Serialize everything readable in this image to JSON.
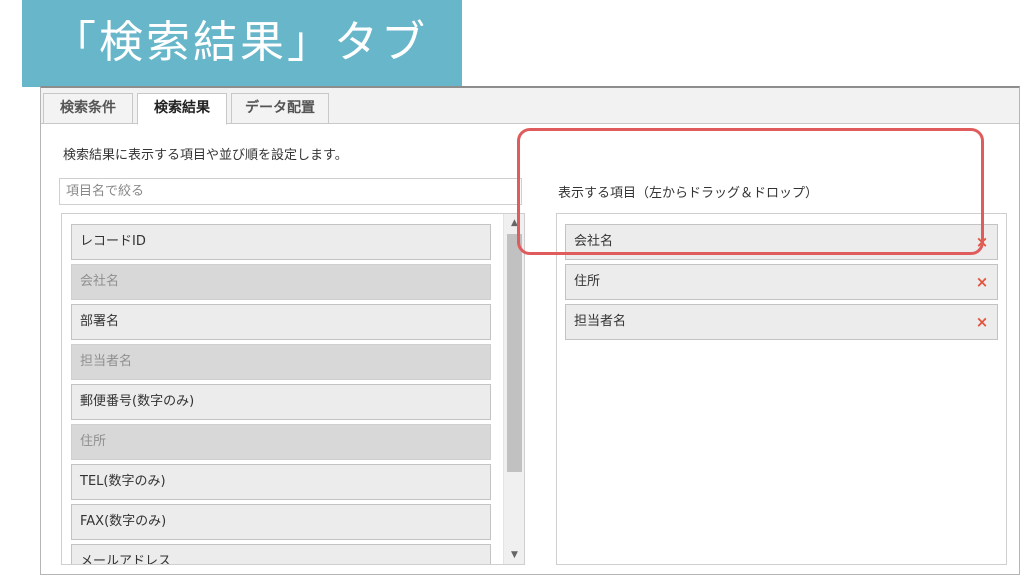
{
  "banner": {
    "title": "「検索結果」タブ"
  },
  "tabs": [
    {
      "label": "検索条件",
      "active": false
    },
    {
      "label": "検索結果",
      "active": true
    },
    {
      "label": "データ配置",
      "active": false
    }
  ],
  "description": "検索結果に表示する項目や並び順を設定します。",
  "filter": {
    "placeholder": "項目名で絞る",
    "value": ""
  },
  "available_items": [
    {
      "label": "レコードID",
      "selected": false
    },
    {
      "label": "会社名",
      "selected": true
    },
    {
      "label": "部署名",
      "selected": false
    },
    {
      "label": "担当者名",
      "selected": true
    },
    {
      "label": "郵便番号(数字のみ)",
      "selected": false
    },
    {
      "label": "住所",
      "selected": true
    },
    {
      "label": "TEL(数字のみ)",
      "selected": false
    },
    {
      "label": "FAX(数字のみ)",
      "selected": false
    },
    {
      "label": "メールアドレス",
      "selected": false
    }
  ],
  "display_items": {
    "title": "表示する項目（左からドラッグ＆ドロップ）",
    "items": [
      "会社名",
      "住所",
      "担当者名"
    ],
    "remove_symbol": "×"
  },
  "scroll": {
    "up_symbol": "▲",
    "down_symbol": "▼"
  },
  "colors": {
    "banner": "#67b6c9",
    "highlight": "#e05c5c",
    "remove": "#e2533d"
  }
}
